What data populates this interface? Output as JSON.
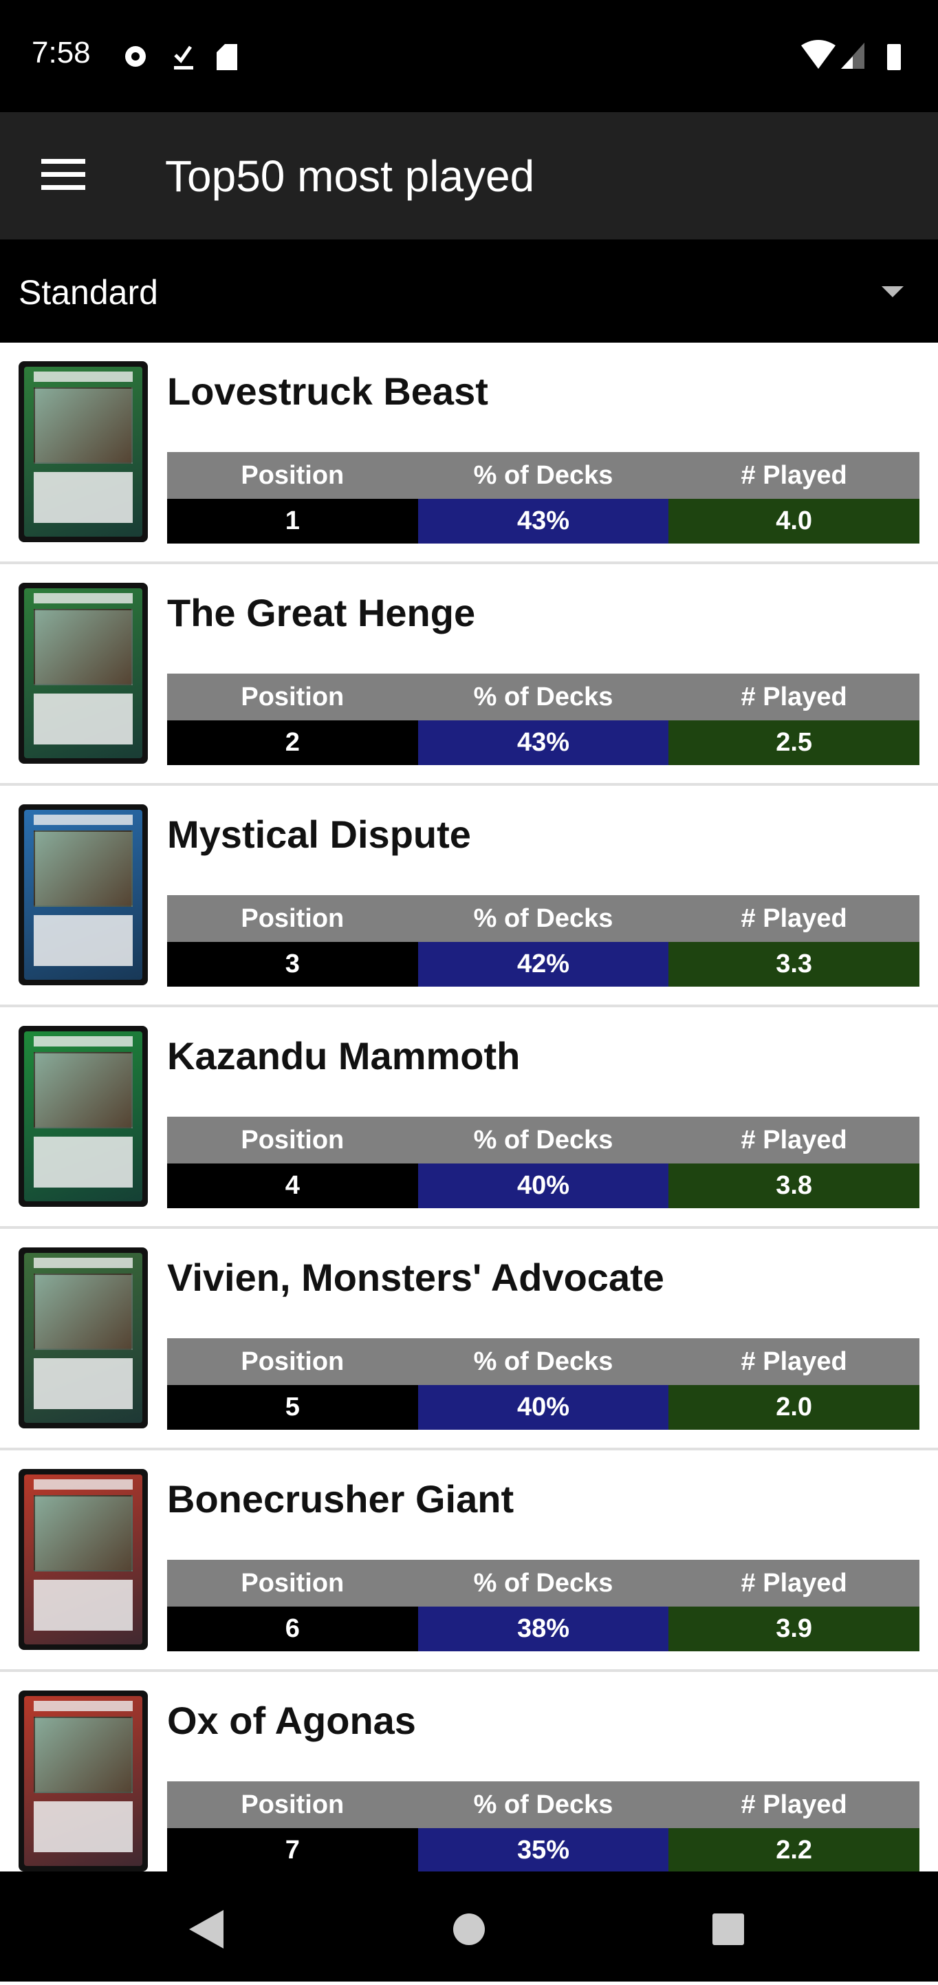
{
  "status_bar": {
    "time": "7:58",
    "icons": [
      "gear-icon",
      "download-done-icon",
      "sd-card-icon",
      "wifi-icon",
      "signal-icon",
      "battery-icon"
    ]
  },
  "app_bar": {
    "title": "Top50 most played",
    "menu_icon": "hamburger-icon"
  },
  "format_select": {
    "value": "Standard"
  },
  "columns": {
    "position": "Position",
    "decks": "% of Decks",
    "played": "# Played"
  },
  "colors": {
    "header": "#808080",
    "position": "#000000",
    "decks": "#1c1f80",
    "played": "#1e4410"
  },
  "cards": [
    {
      "name": "Lovestruck Beast",
      "position": "1",
      "decks": "43%",
      "played": "4.0",
      "frame": "#2e7d3a"
    },
    {
      "name": "The Great Henge",
      "position": "2",
      "decks": "43%",
      "played": "2.5",
      "frame": "#2e7d3a"
    },
    {
      "name": "Mystical Dispute",
      "position": "3",
      "decks": "42%",
      "played": "3.3",
      "frame": "#2a6fb0"
    },
    {
      "name": "Kazandu Mammoth",
      "position": "4",
      "decks": "40%",
      "played": "3.8",
      "frame": "#1f8a3a"
    },
    {
      "name": "Vivien, Monsters' Advocate",
      "position": "5",
      "decks": "40%",
      "played": "2.0",
      "frame": "#3d6e3a"
    },
    {
      "name": "Bonecrusher Giant",
      "position": "6",
      "decks": "38%",
      "played": "3.9",
      "frame": "#b8392a"
    },
    {
      "name": "Ox of Agonas",
      "position": "7",
      "decks": "35%",
      "played": "2.2",
      "frame": "#b8392a"
    }
  ]
}
